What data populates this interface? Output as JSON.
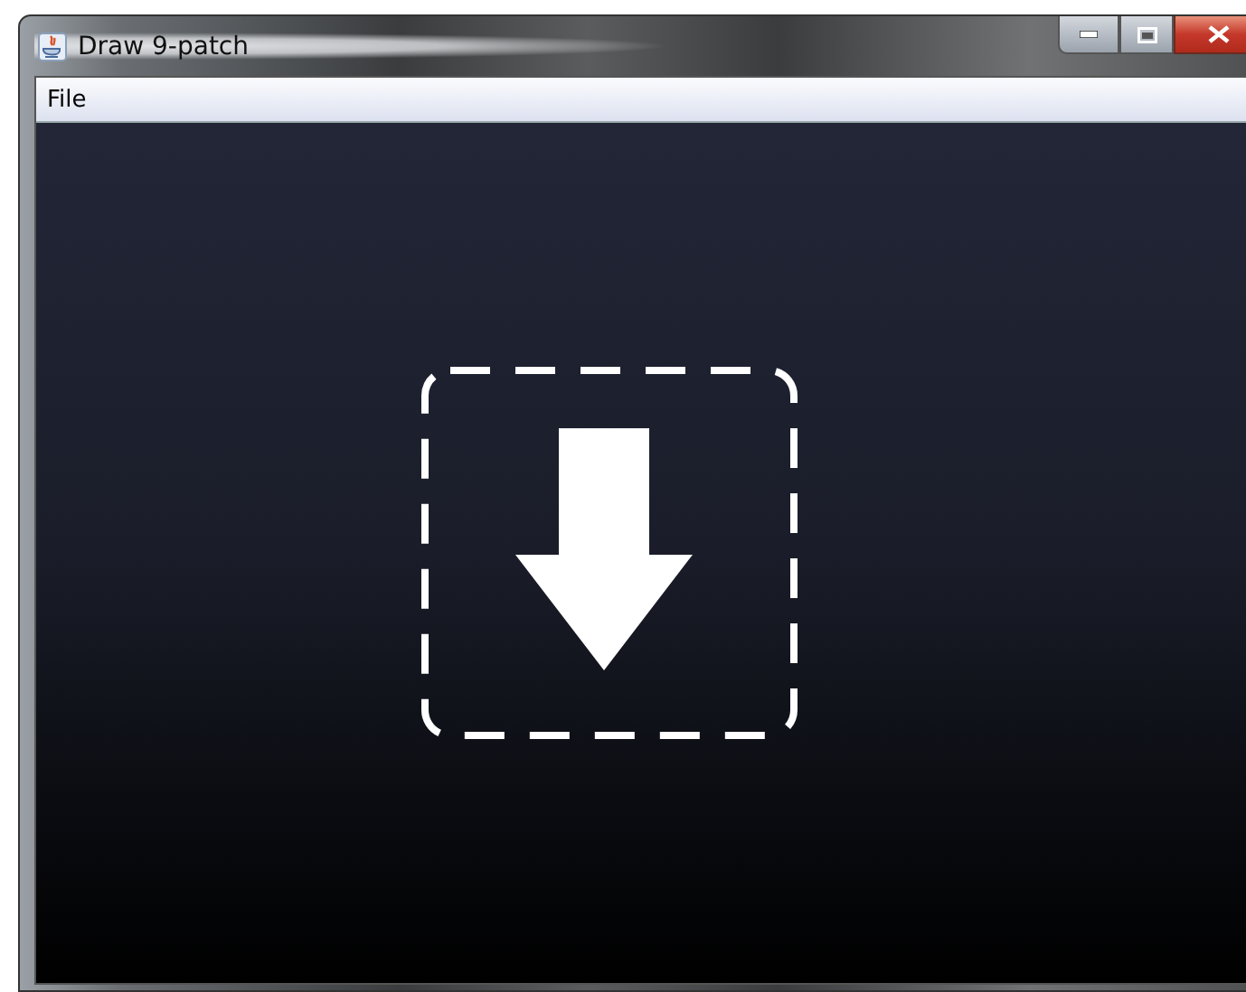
{
  "window": {
    "title": "Draw 9-patch"
  },
  "menu": [
    {
      "label": "File"
    }
  ]
}
